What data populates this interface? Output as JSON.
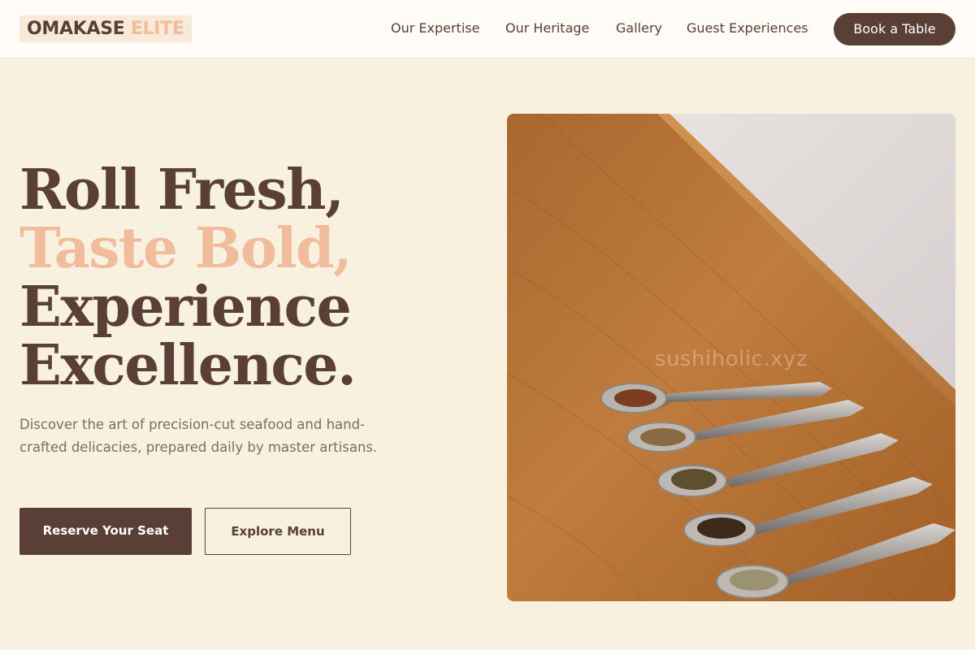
{
  "brand": {
    "name_part1": "OMAKASE",
    "name_part2": "ELITE"
  },
  "nav": {
    "links": [
      "Our Expertise",
      "Our Heritage",
      "Gallery",
      "Guest Experiences"
    ],
    "cta": "Book a Table"
  },
  "hero": {
    "title_lines": [
      "Roll Fresh,",
      "Taste Bold,",
      "Experience",
      "Excellence."
    ],
    "description": "Discover the art of precision-cut seafood and hand-crafted delicacies, prepared daily by master artisans.",
    "primary_button": "Reserve Your Seat",
    "secondary_button": "Explore Menu",
    "image_watermark": "sushiholic.xyz"
  },
  "colors": {
    "background": "#f9f1e0",
    "nav_background": "#fffcf7",
    "primary": "#5a3f36",
    "accent": "#f0bc9b",
    "body_text": "#7d6b63"
  }
}
